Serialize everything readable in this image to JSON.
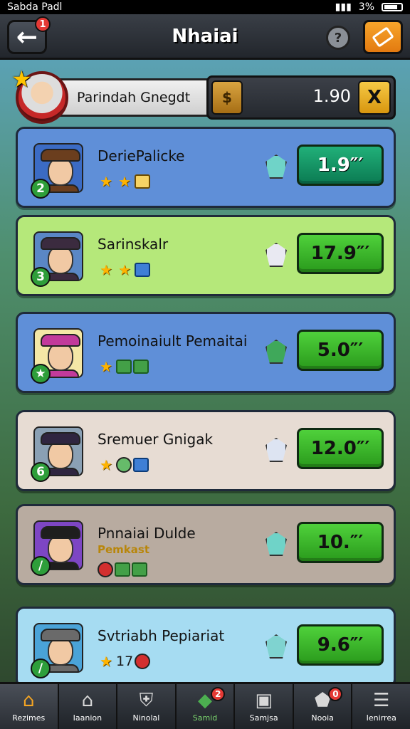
{
  "status_bar": {
    "left_text": "Sabda Padl",
    "right_text": "3%"
  },
  "header": {
    "title": "Nhaiai",
    "back_badge": "1",
    "help_icon": "help-icon",
    "ticket_icon": "ticket-icon"
  },
  "player": {
    "name": "Parindah Gnegdt",
    "coins": "1.90",
    "coin_glyph": "$",
    "add_glyph": "X"
  },
  "rows": [
    {
      "name": "DeriePalicke",
      "sub": "",
      "rank": "2",
      "value": "1.9″′",
      "bg": "#5f8fd8",
      "avatar_bg": "#3b6bc4",
      "hat": "#6b3e1e",
      "gem": "#6fd3c8",
      "btn": "teal",
      "icons": [
        "star",
        "star",
        "boxgold"
      ]
    },
    {
      "name": "Sarinskalr",
      "sub": "",
      "rank": "3",
      "value": "17.9″′",
      "bg": "#b5e87a",
      "avatar_bg": "#5a87c5",
      "hat": "#3b2b3f",
      "gem": "#e9e9f2",
      "btn": "green",
      "icons": [
        "star",
        "star",
        "boxblue"
      ]
    },
    {
      "name": "Pemoinaiult Pemaitai",
      "sub": "",
      "rank": "★",
      "value": "5.0″′",
      "bg": "#5f8fd8",
      "avatar_bg": "#f4e7a6",
      "hat": "#c23a9b",
      "gem": "#3fa85a",
      "btn": "green",
      "icons": [
        "star",
        "box",
        "box"
      ]
    },
    {
      "name": "Sremuer Gnigak",
      "sub": "",
      "rank": "6",
      "value": "12.0″′",
      "bg": "#e7dcd3",
      "avatar_bg": "#8aa0b4",
      "hat": "#2f2540",
      "gem": "#dde4f2",
      "btn": "green",
      "icons": [
        "star",
        "green",
        "boxblue"
      ]
    },
    {
      "name": "Pnnaiai Dulde",
      "sub": "Pemkast",
      "rank": "/",
      "value": "10.″′",
      "bg": "#b8aba0",
      "avatar_bg": "#7d46c4",
      "hat": "#1e1e1e",
      "gem": "#6fd3c8",
      "btn": "green",
      "icons": [
        "red",
        "box",
        "box"
      ]
    },
    {
      "name": "Svtriabh Pepiariat",
      "sub": "",
      "rank": "/",
      "value": "9.6″′",
      "bg": "#a6dcf2",
      "avatar_bg": "#4aa3d8",
      "hat": "#6a6a6a",
      "gem": "#7fd3d0",
      "btn": "green",
      "icons": [
        "star",
        "text17",
        "red"
      ]
    }
  ],
  "nav": [
    {
      "label": "Rezimes",
      "icon": "⌂",
      "icon_name": "home-icon",
      "badge": "",
      "cls": "home"
    },
    {
      "label": "Iaanion",
      "icon": "⌂",
      "icon_name": "house-icon",
      "badge": "",
      "cls": ""
    },
    {
      "label": "Ninolal",
      "icon": "⛨",
      "icon_name": "shield-icon",
      "badge": "",
      "cls": ""
    },
    {
      "label": "Samid",
      "icon": "◆",
      "icon_name": "gem-icon",
      "badge": "2",
      "cls": "special"
    },
    {
      "label": "Samjsa",
      "icon": "▣",
      "icon_name": "profile-icon",
      "badge": "",
      "cls": ""
    },
    {
      "label": "Nooia",
      "icon": "⬟",
      "icon_name": "notification-icon",
      "badge": "0",
      "cls": ""
    },
    {
      "label": "Ienirrea",
      "icon": "☰",
      "icon_name": "menu-icon",
      "badge": "",
      "cls": ""
    }
  ]
}
